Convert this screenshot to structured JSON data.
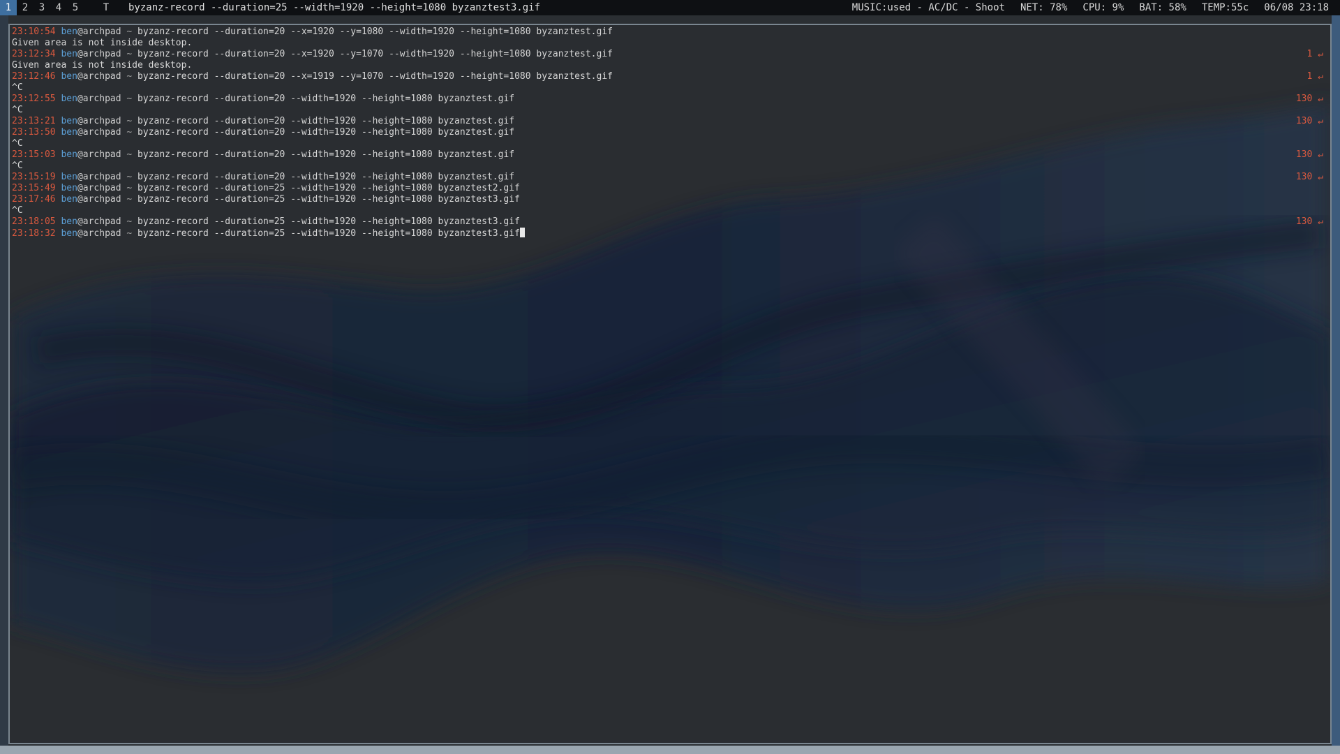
{
  "bar": {
    "workspaces": [
      "1",
      "2",
      "3",
      "4",
      "5"
    ],
    "active_workspace": "1",
    "layout_symbol": "T",
    "window_title": "byzanz-record --duration=25 --width=1920 --height=1080 byzanztest3.gif",
    "status": {
      "music": "MUSIC:used - AC/DC - Shoot",
      "net": "NET: 78%",
      "cpu": "CPU:  9%",
      "bat": "BAT: 58%",
      "temp": "TEMP:55c",
      "datetime": "06/08 23:18"
    }
  },
  "terminal": {
    "lines": [
      {
        "time": "23:10:54",
        "user": "ben",
        "host": "@archpad",
        "cwd": "~",
        "cmd": "byzanz-record --duration=20 --x=1920 --y=1080 --width=1920 --height=1080 byzanztest.gif",
        "ret": ""
      },
      {
        "text": "Given area is not inside desktop."
      },
      {
        "time": "23:12:34",
        "user": "ben",
        "host": "@archpad",
        "cwd": "~",
        "cmd": "byzanz-record --duration=20 --x=1920 --y=1070 --width=1920 --height=1080 byzanztest.gif",
        "ret": "1 ↵"
      },
      {
        "text": "Given area is not inside desktop."
      },
      {
        "time": "23:12:46",
        "user": "ben",
        "host": "@archpad",
        "cwd": "~",
        "cmd": "byzanz-record --duration=20 --x=1919 --y=1070 --width=1920 --height=1080 byzanztest.gif",
        "ret": "1 ↵"
      },
      {
        "text": "^C"
      },
      {
        "time": "23:12:55",
        "user": "ben",
        "host": "@archpad",
        "cwd": "~",
        "cmd": "byzanz-record --duration=20 --width=1920 --height=1080 byzanztest.gif",
        "ret": "130 ↵"
      },
      {
        "text": "^C"
      },
      {
        "time": "23:13:21",
        "user": "ben",
        "host": "@archpad",
        "cwd": "~",
        "cmd": "byzanz-record --duration=20 --width=1920 --height=1080 byzanztest.gif",
        "ret": "130 ↵"
      },
      {
        "time": "23:13:50",
        "user": "ben",
        "host": "@archpad",
        "cwd": "~",
        "cmd": "byzanz-record --duration=20 --width=1920 --height=1080 byzanztest.gif",
        "ret": ""
      },
      {
        "text": "^C"
      },
      {
        "time": "23:15:03",
        "user": "ben",
        "host": "@archpad",
        "cwd": "~",
        "cmd": "byzanz-record --duration=20 --width=1920 --height=1080 byzanztest.gif",
        "ret": "130 ↵"
      },
      {
        "text": "^C"
      },
      {
        "time": "23:15:19",
        "user": "ben",
        "host": "@archpad",
        "cwd": "~",
        "cmd": "byzanz-record --duration=20 --width=1920 --height=1080 byzanztest.gif",
        "ret": "130 ↵"
      },
      {
        "time": "23:15:49",
        "user": "ben",
        "host": "@archpad",
        "cwd": "~",
        "cmd": "byzanz-record --duration=25 --width=1920 --height=1080 byzanztest2.gif",
        "ret": ""
      },
      {
        "time": "23:17:46",
        "user": "ben",
        "host": "@archpad",
        "cwd": "~",
        "cmd": "byzanz-record --duration=25 --width=1920 --height=1080 byzanztest3.gif",
        "ret": ""
      },
      {
        "text": "^C"
      },
      {
        "time": "23:18:05",
        "user": "ben",
        "host": "@archpad",
        "cwd": "~",
        "cmd": "byzanz-record --duration=25 --width=1920 --height=1080 byzanztest3.gif",
        "ret": "130 ↵"
      },
      {
        "time": "23:18:32",
        "user": "ben",
        "host": "@archpad",
        "cwd": "~",
        "cmd": "byzanz-record --duration=25 --width=1920 --height=1080 byzanztest3.gif",
        "ret": "",
        "cursor": true
      }
    ]
  },
  "colors": {
    "timestamp": "#d9593f",
    "user": "#5c9fd6",
    "return_code": "#d9593f",
    "active_workspace_bg": "#3e6fa0",
    "bar_bg": "#0e1013",
    "terminal_bg": "#2a2d31"
  },
  "icons": {
    "return_code": "return-arrow-icon",
    "cursor": "block-cursor-icon"
  }
}
